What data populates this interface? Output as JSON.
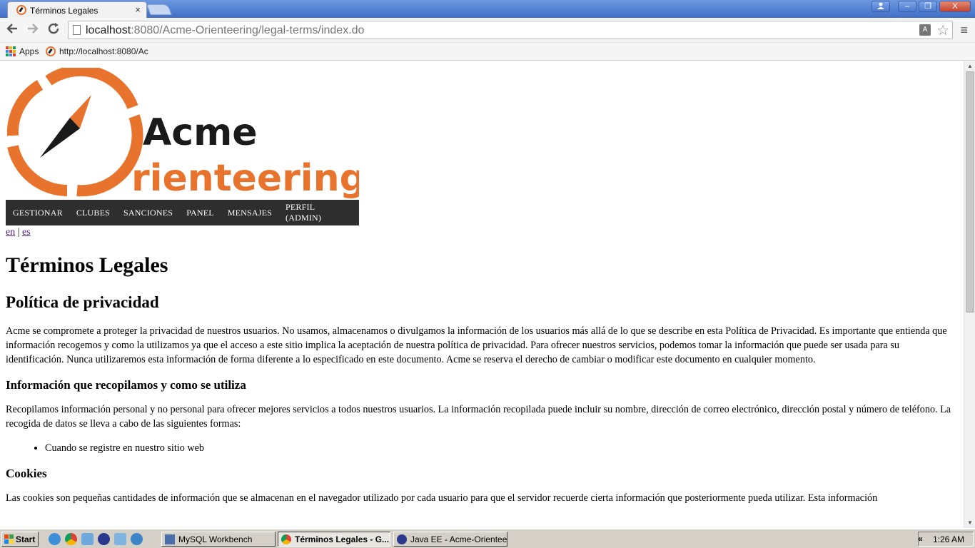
{
  "browser": {
    "tab_title": "Términos Legales",
    "tab_close": "×",
    "url_host": "localhost",
    "url_rest": ":8080/Acme-Orienteering/legal-terms/index.do",
    "bookmarks": [
      {
        "label": "Apps"
      },
      {
        "label": "http://localhost:8080/Ac"
      }
    ],
    "window_buttons": {
      "minimize": "–",
      "restore": "❐",
      "close": "X"
    }
  },
  "page": {
    "logo": {
      "line1": "Acme",
      "line2": "rienteering"
    },
    "nav": [
      {
        "label": "GESTIONAR"
      },
      {
        "label": "CLUBES"
      },
      {
        "label": "SANCIONES"
      },
      {
        "label": "PANEL"
      },
      {
        "label": "MENSAJES"
      },
      {
        "label": "PERFIL (ADMIN)"
      }
    ],
    "lang": {
      "en": "en",
      "separator": " | ",
      "es": "es"
    },
    "title": "Términos Legales",
    "privacy_heading": "Política de privacidad",
    "privacy_text": "Acme se compromete a proteger la privacidad de nuestros usuarios. No usamos, almacenamos o divulgamos la información de los usuarios más allá de lo que se describe en esta Política de Privacidad. Es importante que entienda que información recogemos y como la utilizamos ya que el acceso a este sitio implica la aceptación de nuestra política de privacidad. Para ofrecer nuestros servicios, podemos tomar la información que puede ser usada para su identificación. Nunca utilizaremos esta información de forma diferente a lo especificado en este documento. Acme se reserva el derecho de cambiar o modificar este documento en cualquier momento.",
    "info_heading": "Información que recopilamos y como se utiliza",
    "info_text": "Recopilamos información personal y no personal para ofrecer mejores servicios a todos nuestros usuarios. La información recopilada puede incluir su nombre, dirección de correo electrónico, dirección postal y número de teléfono. La recogida de datos se lleva a cabo de las siguientes formas:",
    "info_items": [
      "Cuando se registre en nuestro sitio web"
    ],
    "cookies_heading": "Cookies",
    "cookies_text": "Las cookies son pequeñas cantidades de información que se almacenan en el navegador utilizado por cada usuario para que el servidor recuerde cierta información que posteriormente pueda utilizar. Esta información"
  },
  "taskbar": {
    "start": "Start",
    "tasks": [
      {
        "label": "MySQL Workbench"
      },
      {
        "label": "Términos Legales - G..."
      },
      {
        "label": "Java EE - Acme-Orientee..."
      }
    ],
    "chevron": "«",
    "clock": "1:26 AM"
  },
  "colors": {
    "brand_orange": "#e8732c",
    "nav_bg": "#2e2e2e",
    "link": "#551a8b",
    "titlebar": "#4a7bd0"
  }
}
